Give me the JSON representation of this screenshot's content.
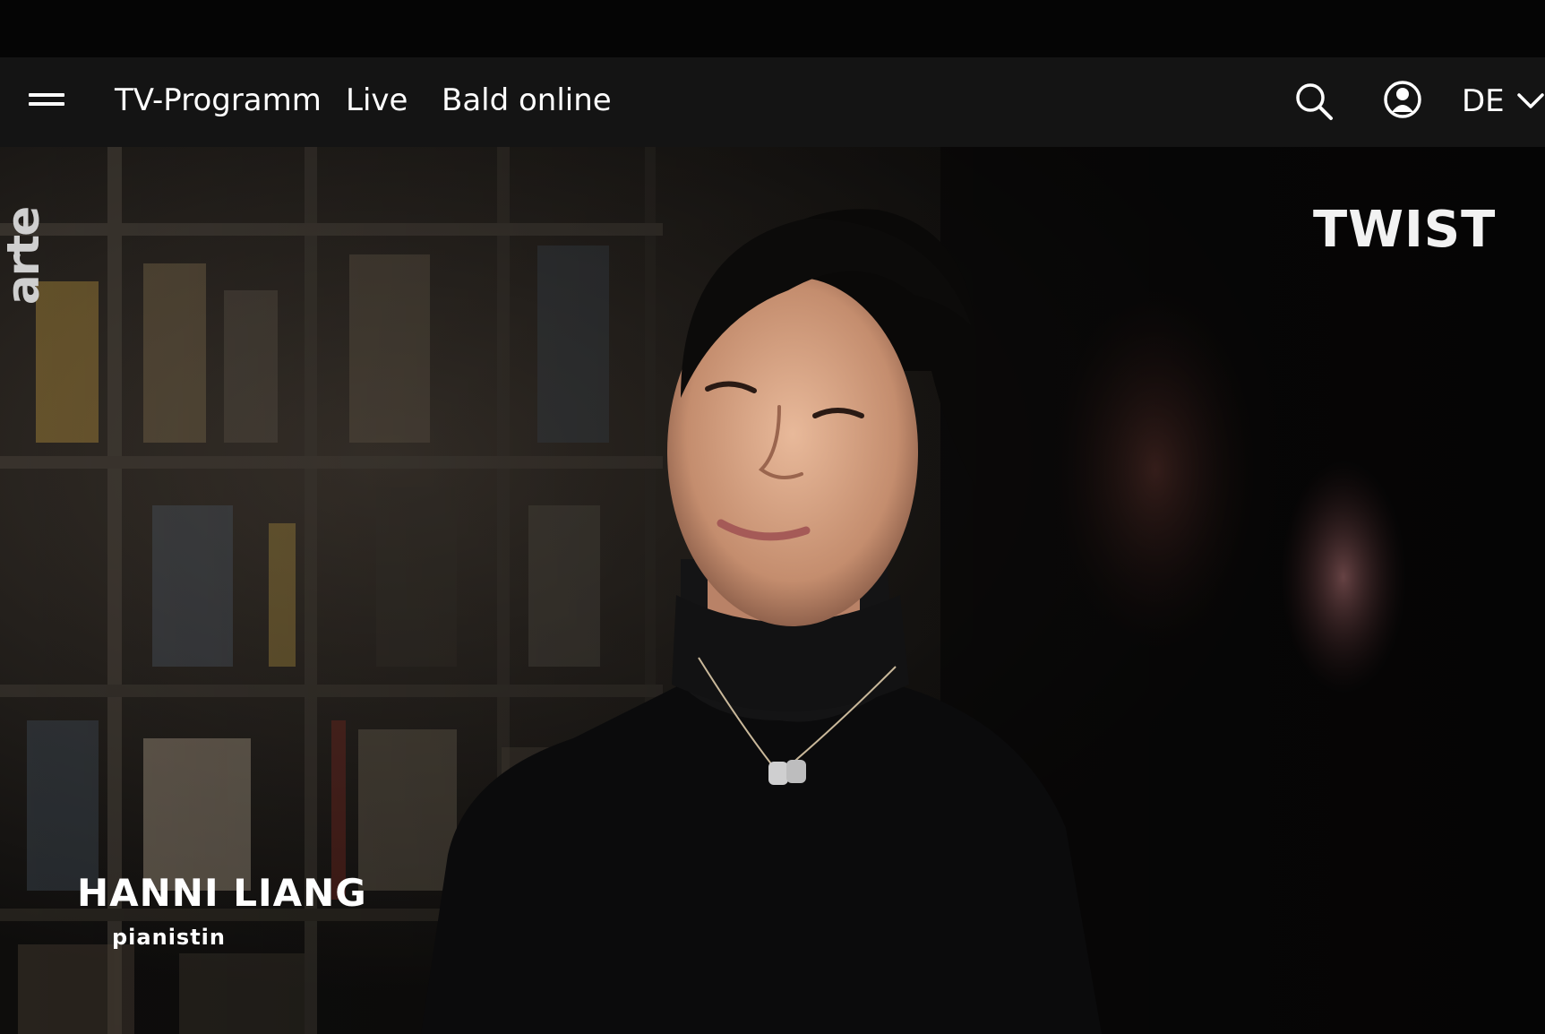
{
  "nav": {
    "links": [
      "TV-Programm",
      "Live",
      "Bald online"
    ],
    "language": "DE"
  },
  "video": {
    "channel_logo": "arte",
    "show_logo": "TWIST",
    "lower_third": {
      "name": "HANNI LIANG",
      "role": "pianistin"
    }
  },
  "icons": {
    "menu": "hamburger-menu-icon",
    "search": "search-icon",
    "account": "user-account-icon",
    "language_dropdown": "chevron-down-icon"
  },
  "colors": {
    "navbar": "#141414",
    "top_strip": "#050505",
    "text": "#ffffff"
  }
}
